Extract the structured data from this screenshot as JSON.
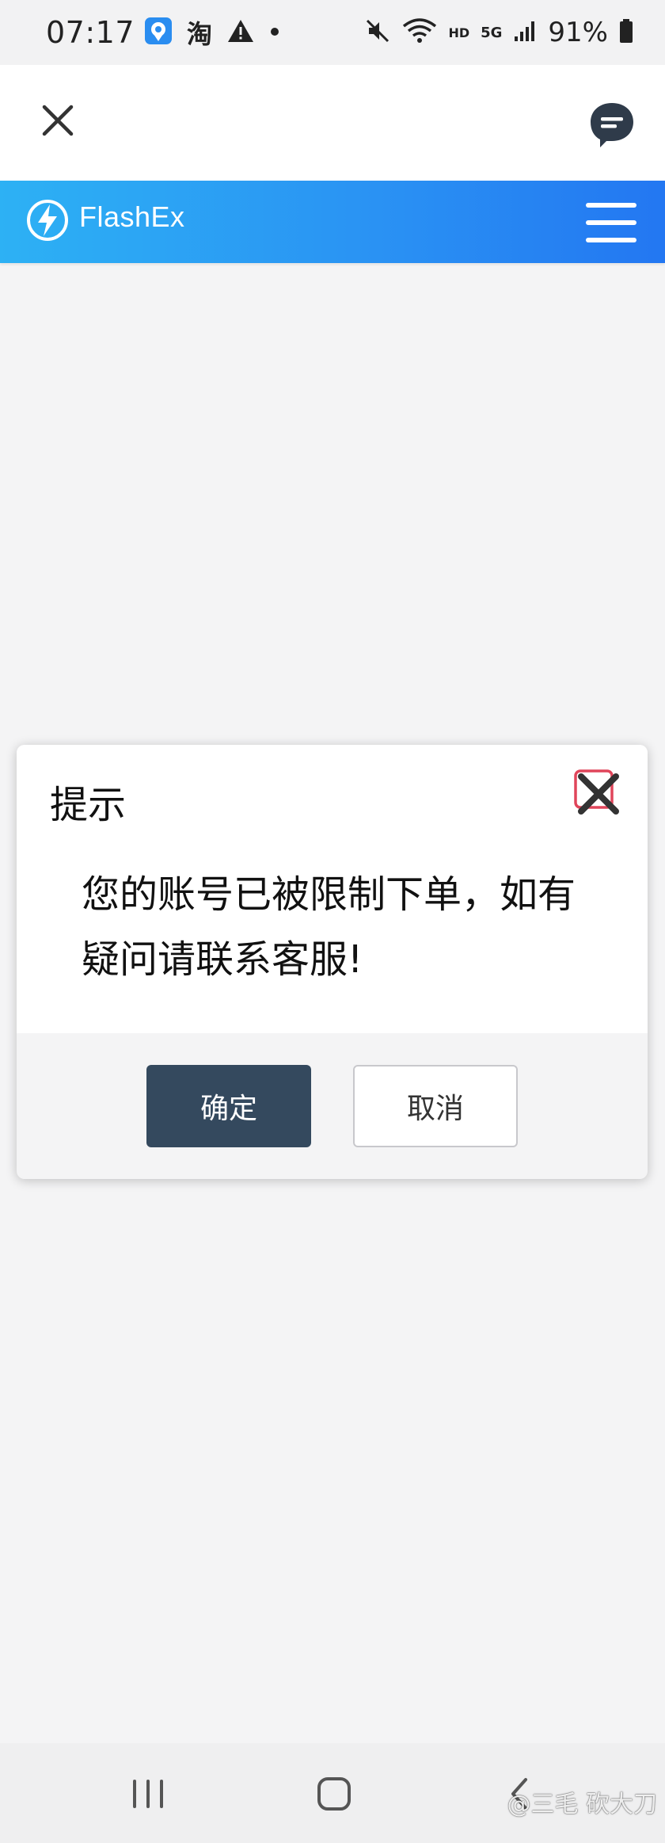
{
  "status_bar": {
    "time": "07:17",
    "left_icons": [
      "location-app-icon",
      "taobao-icon",
      "warning-icon",
      "dot-icon"
    ],
    "taobao_label": "淘",
    "network_hd": "HD",
    "network_5g": "5G",
    "battery_percent": "91%",
    "right_icons": [
      "mute-icon",
      "wifi-icon",
      "signal-icon",
      "battery-icon"
    ]
  },
  "topbar": {
    "close_icon": "close-icon",
    "chat_icon": "chat-bubble-icon"
  },
  "brand": {
    "name": "FlashEx",
    "logo_icon": "lightning-logo-icon",
    "menu_icon": "hamburger-menu-icon",
    "gradient_start": "#2db1f4",
    "gradient_end": "#2377f2"
  },
  "dialog": {
    "title": "提示",
    "message": "您的账号已被限制下单，如有疑问请联系客服!",
    "confirm_label": "确定",
    "cancel_label": "取消",
    "confirm_color": "#34495e",
    "close_icon": "dialog-close-icon"
  },
  "nav_bar": {
    "recent_icon": "recent-apps-icon",
    "home_icon": "home-icon",
    "back_icon": "back-icon"
  },
  "watermark": {
    "text": "@三毛 砍大刀"
  }
}
